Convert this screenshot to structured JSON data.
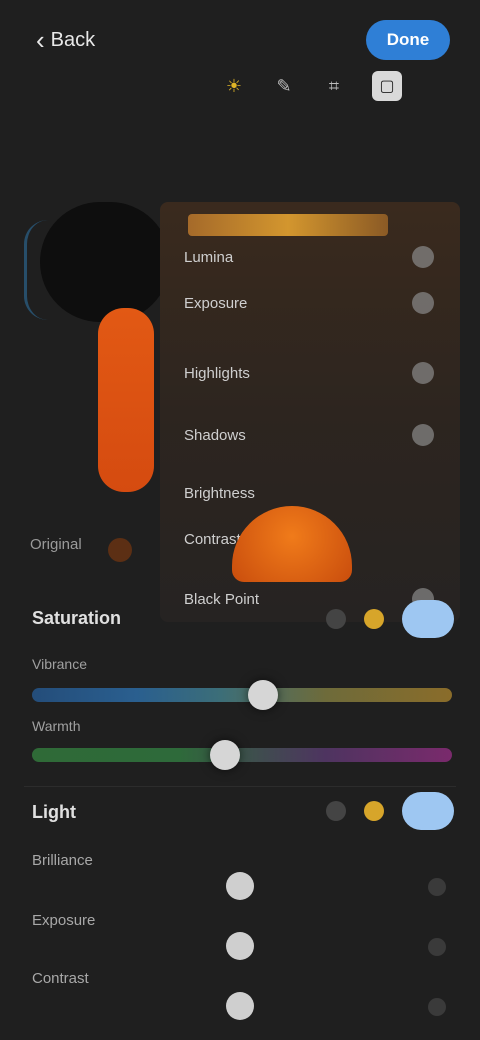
{
  "header": {
    "back_label": "Back",
    "done_label": "Done"
  },
  "tools": [
    {
      "icon": "sun-icon",
      "glyph": "☀"
    },
    {
      "icon": "pencil-icon",
      "glyph": "✎"
    },
    {
      "icon": "crop-icon",
      "glyph": "⌗"
    },
    {
      "icon": "square-icon",
      "glyph": "▢"
    }
  ],
  "menu": {
    "items": [
      {
        "label": "Lumina"
      },
      {
        "label": "Exposure"
      },
      {
        "label": "Highlights"
      },
      {
        "label": "Shadows"
      },
      {
        "label": "Brightness"
      },
      {
        "label": "Contrast"
      },
      {
        "label": "Black Point"
      }
    ]
  },
  "caption": "Original",
  "section_a": {
    "title": "Saturation",
    "slider1_label": "Vibrance",
    "slider2_label": "Warmth",
    "slider1_value": 0.55,
    "slider2_value": 0.46
  },
  "section_b": {
    "title": "Light",
    "rows": [
      {
        "label": "Brilliance",
        "value": 0.5
      },
      {
        "label": "Exposure",
        "value": 0.5
      },
      {
        "label": "Contrast",
        "value": 0.5
      }
    ]
  },
  "colors": {
    "accent_blue": "#2f7fd6",
    "accent_orange": "#e25914",
    "gold": "#d7a52a"
  }
}
